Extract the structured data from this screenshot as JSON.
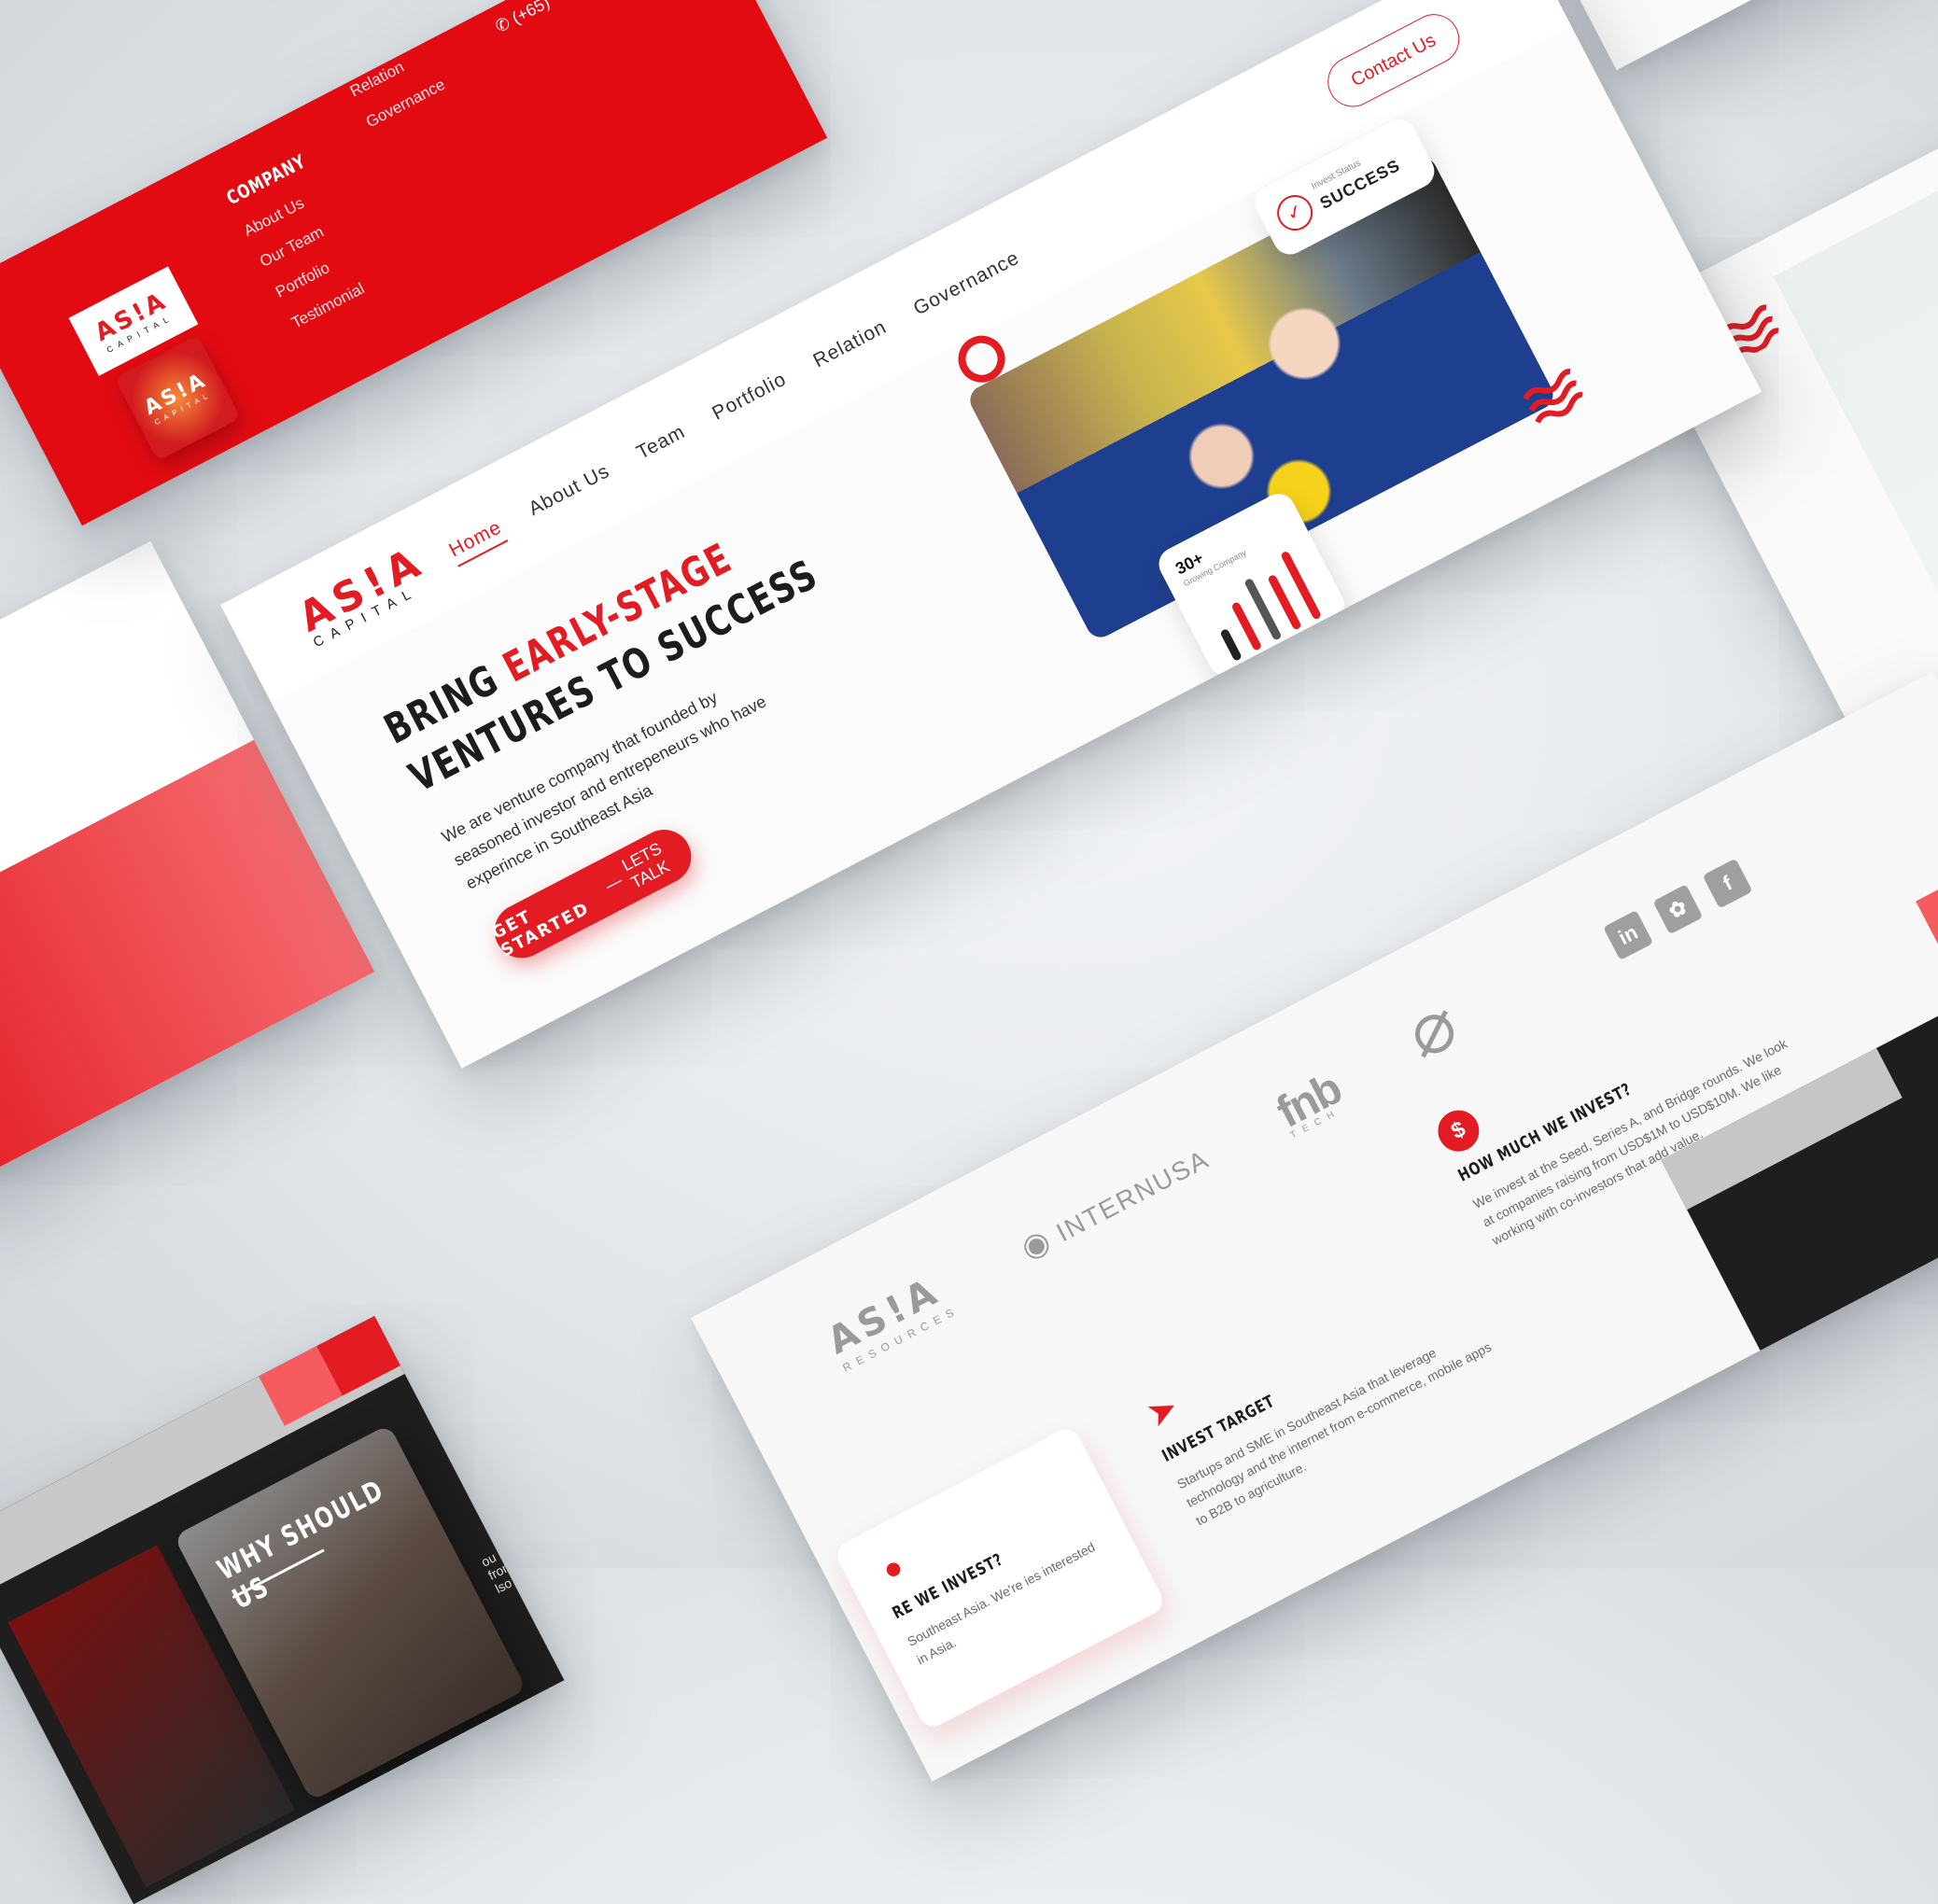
{
  "footer_card": {
    "logo_main": "AS!A",
    "logo_sub": "CAPITAL",
    "company_heading": "COMPANY",
    "company_links": [
      "About Us",
      "Our Team",
      "Portfolio",
      "Testimonial"
    ],
    "other_links": [
      "Relation",
      "Governance"
    ],
    "phone_partial": "(+65)"
  },
  "hero": {
    "logo_main": "AS!A",
    "logo_sub": "CAPITAL",
    "nav": [
      "Home",
      "About Us",
      "Team",
      "Portfolio",
      "Relation",
      "Governance"
    ],
    "contact_label": "Contact Us",
    "headline_part1": "BRING ",
    "headline_accent": "EARLY-STAGE",
    "headline_part2": "VENTURES TO SUCCESS",
    "description": "We are venture company that founded by seasoned investor and entrepeneurs who have experince in Southeast Asia",
    "cta_primary": "GET STARTED",
    "cta_separator": "—",
    "cta_secondary": "LETS TALK",
    "status_small": "Invest Status",
    "status_big": "SUCCESS",
    "growth_number": "30+",
    "growth_label": "Growing Company",
    "growth_bars": [
      0.45,
      0.7,
      0.9,
      0.8,
      1.0
    ]
  },
  "why_card": {
    "title": "WHY SHOULD US",
    "snippet_line1": "ou from",
    "snippet_line2": "lso"
  },
  "partners_card": {
    "partners": [
      {
        "main": "AS!A",
        "sub": "RESOURCES"
      },
      {
        "main": "INTERNUSA"
      },
      {
        "main": "fnb",
        "sub": "TECH"
      }
    ],
    "social_icons": [
      "linkedin-icon",
      "twitter-icon",
      "facebook-icon"
    ],
    "invest_target_heading": "INVEST TARGET",
    "invest_target_text": "Startups and SME in Southeast Asia that leverage technology and the internet from e-commerce, mobile apps to B2B to agriculture.",
    "how_much_heading": "HOW MUCH WE INVEST?",
    "how_much_text": "We invest at the Seed, Series A, and Bridge rounds. We look at companies raising from USD$1M to USD$10M. We like working with co-investors that add value.",
    "where_heading": "RE WE INVEST?",
    "where_text": "Southeast Asia. We're ies interested in Asia."
  },
  "colors": {
    "accent": "#e31b23",
    "dark": "#1c1c1c"
  }
}
